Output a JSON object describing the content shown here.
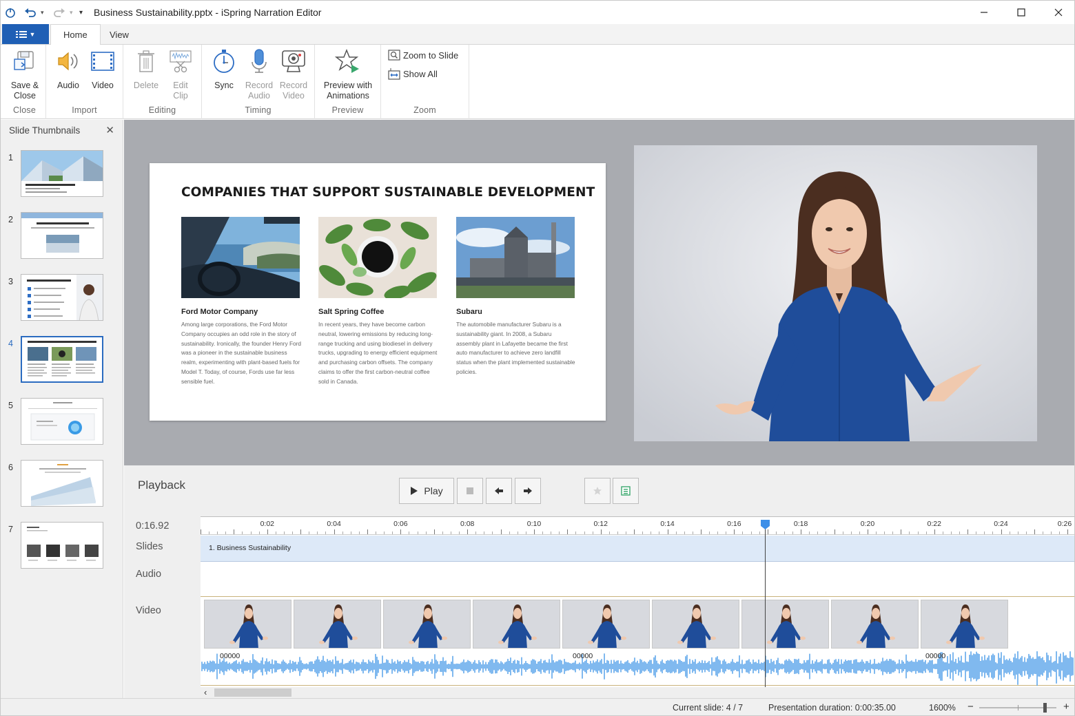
{
  "app": {
    "title": "Business Sustainability.pptx - iSpring Narration Editor"
  },
  "ribbon": {
    "tabs": [
      {
        "label": "Home",
        "active": true
      },
      {
        "label": "View",
        "active": false
      }
    ],
    "groups": {
      "close": {
        "label": "Close",
        "buttons": [
          {
            "label1": "Save &",
            "label2": "Close",
            "icon": "save-close-icon"
          }
        ]
      },
      "import": {
        "label": "Import",
        "buttons": [
          {
            "label": "Audio",
            "icon": "speaker-icon"
          },
          {
            "label": "Video",
            "icon": "film-icon"
          }
        ]
      },
      "editing": {
        "label": "Editing",
        "buttons": [
          {
            "label": "Delete",
            "icon": "trash-icon",
            "enabled": false
          },
          {
            "label1": "Edit",
            "label2": "Clip",
            "icon": "edit-clip-icon",
            "enabled": false
          }
        ]
      },
      "timing": {
        "label": "Timing",
        "buttons": [
          {
            "label": "Sync",
            "icon": "stopwatch-icon"
          },
          {
            "label1": "Record",
            "label2": "Audio",
            "icon": "microphone-icon",
            "enabled": false
          },
          {
            "label1": "Record",
            "label2": "Video",
            "icon": "webcam-icon",
            "enabled": false
          }
        ]
      },
      "preview": {
        "label": "Preview",
        "buttons": [
          {
            "label1": "Preview with",
            "label2": "Animations",
            "icon": "star-play-icon"
          }
        ]
      },
      "zoom": {
        "label": "Zoom",
        "buttons": [
          {
            "label": "Zoom to Slide",
            "icon": "zoom-slide-icon"
          },
          {
            "label": "Show All",
            "icon": "show-all-icon"
          }
        ]
      }
    }
  },
  "thumbnails": {
    "title": "Slide Thumbnails",
    "selected": 4,
    "items": [
      "1",
      "2",
      "3",
      "4",
      "5",
      "6",
      "7"
    ]
  },
  "slide": {
    "title": "COMPANIES THAT SUPPORT SUSTAINABLE DEVELOPMENT",
    "cards": [
      {
        "name": "Ford Motor Company",
        "text": "Among large corporations, the Ford Motor Company occupies an odd role in the story of sustainability. Ironically, the founder Henry Ford was a pioneer in the sustainable business realm, experimenting with plant-based fuels for Model T. Today, of course, Fords use far less sensible fuel."
      },
      {
        "name": "Salt Spring Coffee",
        "text": "In recent years, they have become carbon neutral, lowering emissions by reducing long-range trucking and using biodiesel in delivery trucks, upgrading to energy efficient equipment and purchasing carbon offsets. The company claims to offer the first carbon-neutral coffee sold in Canada."
      },
      {
        "name": "Subaru",
        "text": "The automobile manufacturer Subaru is a sustainability giant. In 2008, a Subaru assembly plant in Lafayette became the first auto manufacturer to achieve zero landfill status when the plant implemented sustainable policies."
      }
    ]
  },
  "playback": {
    "title": "Playback",
    "play_label": "Play",
    "current_time": "0:16.92",
    "playhead_seconds": 16.92,
    "timeline_end_seconds": 26.2,
    "row_labels": {
      "slides": "Slides",
      "audio": "Audio",
      "video": "Video"
    },
    "ruler_labels": [
      "0:02",
      "0:04",
      "0:06",
      "0:08",
      "0:10",
      "0:12",
      "0:14",
      "0:16",
      "0:18",
      "0:20",
      "0:22",
      "0:24",
      "0:26"
    ],
    "slide_segment": "1. Business Sustainability",
    "wave_labels": [
      "00000",
      "00000",
      "00000"
    ],
    "video_frame_count": 9
  },
  "status": {
    "current_slide": "Current slide: 4 / 7",
    "duration": "Presentation duration: 0:00:35.00",
    "zoom": "1600%",
    "zoom_level": 0.85
  },
  "colors": {
    "accent": "#1f5fb5",
    "playhead": "#3d8fe8",
    "slides_track": "#dde9f8",
    "waveform": "#4a9be8"
  }
}
